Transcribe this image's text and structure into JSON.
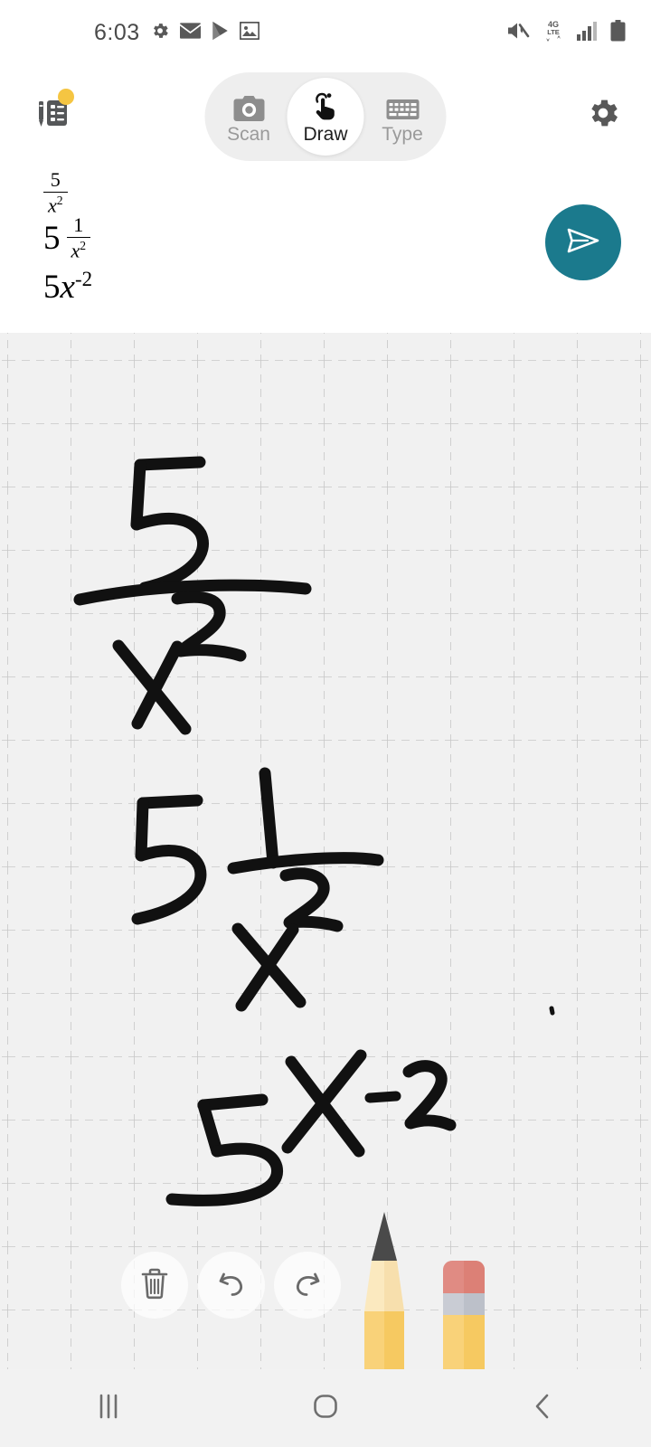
{
  "status_bar": {
    "time": "6:03",
    "left_icons": [
      "gear-icon",
      "mail-icon",
      "play-store-icon",
      "image-icon"
    ],
    "right_icons": [
      "mute-icon",
      "4g-lte-icon",
      "signal-bars-icon",
      "battery-icon"
    ],
    "network_label_top": "4G",
    "network_label_bottom": "LTE"
  },
  "top_bar": {
    "notes_button": "history-notes-icon",
    "notes_badge": "unread-dot",
    "settings_button": "gear-icon",
    "modes": [
      {
        "label": "Scan",
        "icon": "camera-icon",
        "active": false
      },
      {
        "label": "Draw",
        "icon": "hand-draw-icon",
        "active": true
      },
      {
        "label": "Type",
        "icon": "keyboard-icon",
        "active": false
      }
    ]
  },
  "recognized": {
    "expressions": [
      {
        "type": "fraction",
        "numerator": "5",
        "denominator_base": "x",
        "denominator_exp": "2",
        "latex": "\\frac{5}{x^2}"
      },
      {
        "type": "coefficient_fraction",
        "coefficient": "5",
        "numerator": "1",
        "denominator_base": "x",
        "denominator_exp": "2",
        "latex": "5\\frac{1}{x^2}"
      },
      {
        "type": "power",
        "coefficient": "5",
        "base": "x",
        "exponent": "-2",
        "latex": "5x^{-2}"
      }
    ],
    "send_button": "send-icon",
    "send_button_color": "#1b7a8d"
  },
  "canvas": {
    "background_color": "#f1f1f1",
    "grid_color": "#c9c9c9",
    "grid_spacing_px": 70,
    "grid_style": "dashed",
    "ink_color": "#111111",
    "strokes_description": [
      "handwritten 5 over fraction bar with x squared below",
      "handwritten 5 then 1 over x squared",
      "handwritten 5 x superscript minus 2"
    ]
  },
  "tools": {
    "items": [
      {
        "name": "trash-icon",
        "label": "Delete"
      },
      {
        "name": "undo-icon",
        "label": "Undo"
      },
      {
        "name": "redo-icon",
        "label": "Redo"
      },
      {
        "name": "pencil-tool-icon",
        "label": "Pencil",
        "selected": true
      },
      {
        "name": "eraser-tool-icon",
        "label": "Eraser",
        "selected": false
      }
    ],
    "pencil_colors": {
      "tip": "#4a4a4a",
      "body_light": "#fbe9bf",
      "body_dark": "#f6c960"
    },
    "eraser_colors": {
      "top": "#e08b83",
      "band": "#c3c7cf",
      "body": "#f6c960"
    }
  },
  "nav_bar": {
    "buttons": [
      {
        "name": "recents-button",
        "icon": "recents-icon"
      },
      {
        "name": "home-button",
        "icon": "home-icon"
      },
      {
        "name": "back-button",
        "icon": "back-chevron-icon"
      }
    ]
  }
}
